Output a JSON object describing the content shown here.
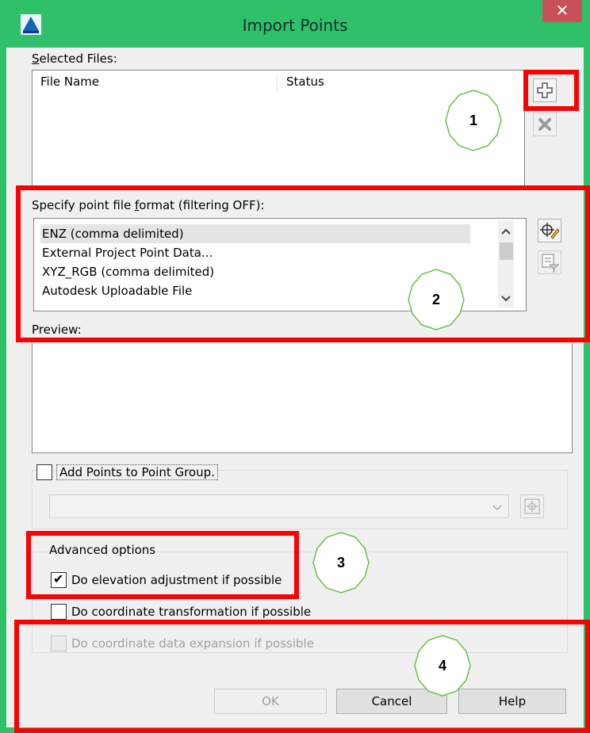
{
  "window": {
    "title": "Import Points",
    "close_glyph": "✕"
  },
  "selected_files": {
    "label": "Selected Files:",
    "label_mnemonic": "S",
    "label_rest": "elected Files:",
    "columns": [
      "File Name",
      "Status"
    ],
    "add_button_icon": "add-file-icon",
    "remove_button_icon": "remove-file-icon"
  },
  "format": {
    "label_before": "Specify point file ",
    "label_mnemonic": "f",
    "label_after": "ormat (filtering OFF):",
    "items": [
      "ENZ (comma delimited)",
      "External Project Point Data...",
      "XYZ_RGB (comma delimited)",
      "Autodesk Uploadable File"
    ],
    "selected_index": 0,
    "edit_button_icon": "edit-format-icon",
    "filter_button_icon": "filter-format-icon"
  },
  "preview": {
    "label": "Preview:"
  },
  "point_group": {
    "checkbox_label": "Add Points to Point Group.",
    "checked": false,
    "dropdown_value": "",
    "picker_icon": "point-group-picker-icon"
  },
  "advanced": {
    "legend": "Advanced options",
    "options": [
      {
        "label": "Do elevation adjustment if possible",
        "checked": true,
        "enabled": true
      },
      {
        "label": "Do coordinate transformation if possible",
        "checked": false,
        "enabled": true
      },
      {
        "label": "Do coordinate data expansion if possible",
        "checked": false,
        "enabled": false
      }
    ]
  },
  "buttons": {
    "ok": "OK",
    "cancel": "Cancel",
    "help": "Help"
  },
  "callouts": [
    "1",
    "2",
    "3",
    "4"
  ],
  "colors": {
    "title_bar": "#2fc06a",
    "close_button": "#c7505a",
    "highlight_box": "#ff0000",
    "callout_fill": "#ffffff",
    "callout_outline": "#6abf4b"
  }
}
